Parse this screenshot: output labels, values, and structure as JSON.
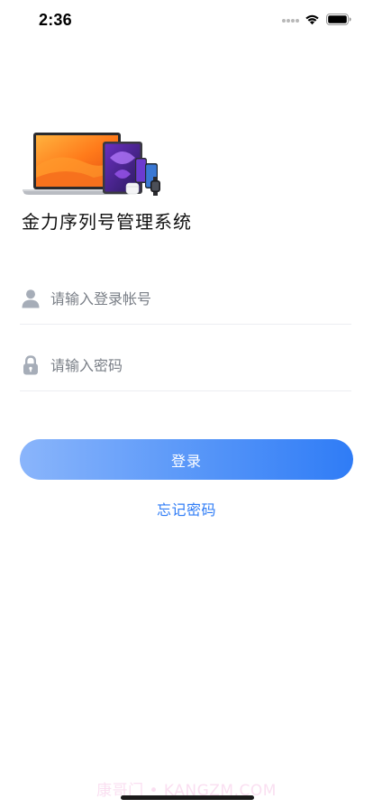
{
  "status_bar": {
    "time": "2:36",
    "icons": [
      "signal-dots-icon",
      "wifi-icon",
      "battery-icon"
    ]
  },
  "app": {
    "title": "金力序列号管理系统",
    "hero_image": "apple-devices-banner"
  },
  "form": {
    "account": {
      "placeholder": "请输入登录帐号",
      "value": "",
      "icon": "user-icon"
    },
    "password": {
      "placeholder": "请输入密码",
      "value": "",
      "icon": "lock-icon"
    },
    "login_label": "登录",
    "forgot_label": "忘记密码"
  },
  "watermark": "康哥门 • KANGZM.COM",
  "colors": {
    "accent": "#2f7cf6",
    "button_gradient_start": "#8ab5fb",
    "button_gradient_end": "#2f7cf6",
    "icon_gray": "#a6adb8"
  }
}
